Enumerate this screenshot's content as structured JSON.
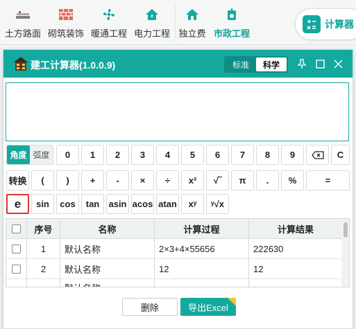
{
  "ribbon": {
    "items": [
      {
        "label": "土方路面",
        "icon": "road-roller-icon"
      },
      {
        "label": "砌筑装饰",
        "icon": "brick-wall-icon"
      },
      {
        "label": "暖通工程",
        "icon": "fan-icon"
      },
      {
        "label": "电力工程",
        "icon": "electric-house-icon"
      },
      {
        "label": "独立费",
        "icon": "house-icon"
      },
      {
        "label": "市政工程",
        "icon": "municipal-icon",
        "active": true
      }
    ],
    "calculator_label": "计算器"
  },
  "dialog": {
    "title": "建工计算器(1.0.0.9)",
    "modes": [
      "标准",
      "科学"
    ],
    "active_mode": "科学"
  },
  "display": {
    "value": ""
  },
  "keypad": {
    "angle": [
      "角度",
      "弧度"
    ],
    "row1": [
      "0",
      "1",
      "2",
      "3",
      "4",
      "5",
      "6",
      "7",
      "8",
      "9",
      "⌫",
      "C"
    ],
    "row2": [
      "转换",
      "(",
      ")",
      "+",
      "-",
      "×",
      "÷",
      "x²",
      "√‾",
      "π",
      ".",
      "%",
      "="
    ],
    "row3": [
      "e",
      "sin",
      "cos",
      "tan",
      "asin",
      "acos",
      "atan",
      "xʸ",
      "ʸ√x"
    ]
  },
  "table": {
    "headers": [
      "序号",
      "名称",
      "计算过程",
      "计算结果"
    ],
    "rows": [
      {
        "index": "1",
        "name": "默认名称",
        "process": "2×3+4×55656",
        "result": "222630"
      },
      {
        "index": "2",
        "name": "默认名称",
        "process": "12",
        "result": "12"
      },
      {
        "index": "",
        "name": "默认名称",
        "process": "",
        "result": ""
      }
    ]
  },
  "buttons": {
    "delete": "删除",
    "export": "导出Excel"
  },
  "colors": {
    "accent": "#14a99f",
    "highlight_border": "#dd3333"
  }
}
